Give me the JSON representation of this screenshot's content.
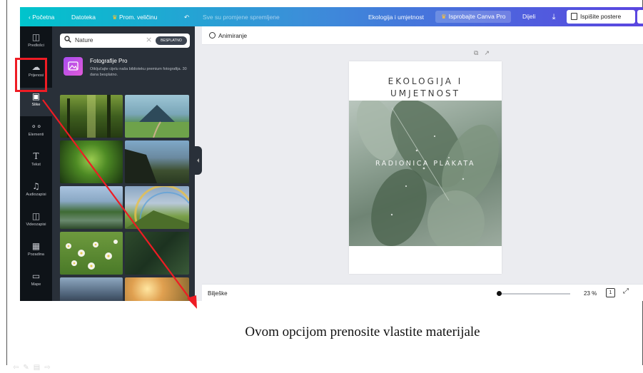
{
  "topbar": {
    "home": "Početna",
    "file": "Datoteka",
    "resize": "Prom. veličinu",
    "saved_status": "Sve su promjene spremljene",
    "design_title": "Ekologija i umjetnost",
    "try_pro": "Isprobajte Canva Pro",
    "share": "Dijeli",
    "download_icon": "download-icon",
    "print": "Ispišite postere"
  },
  "rail": {
    "items": [
      {
        "label": "Predlošci",
        "icon": "template-icon"
      },
      {
        "label": "Prijenosi",
        "icon": "upload-cloud-icon"
      },
      {
        "label": "Slike",
        "icon": "image-icon"
      },
      {
        "label": "Elementi",
        "icon": "shapes-icon"
      },
      {
        "label": "Tekst",
        "icon": "text-icon"
      },
      {
        "label": "Audiozapisi",
        "icon": "music-icon"
      },
      {
        "label": "Videozapisi",
        "icon": "video-icon"
      },
      {
        "label": "Pozadina",
        "icon": "background-icon"
      },
      {
        "label": "Mape",
        "icon": "folder-icon"
      }
    ],
    "active_index": 2
  },
  "panel": {
    "search_value": "Nature",
    "search_badge": "BESPLATNO",
    "promo_title": "Fotografije Pro",
    "promo_text": "Otključajte cijelu naša biblioteku premium fotografija. 30 dana besplatno."
  },
  "editor": {
    "animate": "Animiranje",
    "page_title": "EKOLOGIJA I\nUMJETNOST",
    "page_subtitle": "RADIONICA PLAKATA",
    "notes": "Bilješke",
    "zoom": "23 %",
    "page_number": "1",
    "zoom_level_fraction": 0.0
  },
  "annotation": {
    "caption": "Ovom opcijom prenosite vlastite materijale",
    "highlight_color": "#ee1c24"
  },
  "colors": {
    "rail_bg": "#0e1318",
    "panel_bg": "#293039",
    "canvas_bg": "#ebecf0",
    "accent_start": "#00c4cc",
    "accent_end": "#5a45e0"
  }
}
